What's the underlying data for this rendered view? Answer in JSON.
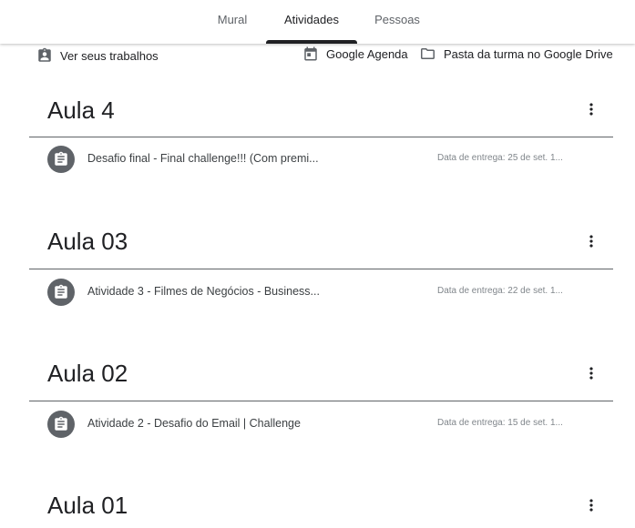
{
  "nav": {
    "tabs": [
      {
        "label": "Mural"
      },
      {
        "label": "Atividades"
      },
      {
        "label": "Pessoas"
      }
    ],
    "active_tab": "Atividades"
  },
  "toolbar": {
    "view_work_label": "Ver seus trabalhos",
    "calendar_label": "Google Agenda",
    "drive_label": "Pasta da turma no Google Drive"
  },
  "topics": [
    {
      "title": "Aula 4",
      "assignment": {
        "title": "Desafio final - Final challenge!!! (Com premi...",
        "due": "Data de entrega: 25 de set. 1..."
      }
    },
    {
      "title": "Aula 03",
      "assignment": {
        "title": "Atividade 3 - Filmes de Negócios - Business...",
        "due": "Data de entrega: 22 de set. 1..."
      }
    },
    {
      "title": "Aula 02",
      "assignment": {
        "title": "Atividade 2 - Desafio do Email | Challenge",
        "due": "Data de entrega: 15 de set. 1..."
      }
    },
    {
      "title": "Aula 01"
    }
  ],
  "icons": {
    "view_work": "assignment-ind-icon",
    "calendar": "calendar-icon",
    "drive": "folder-icon",
    "assignment": "assignment-icon",
    "menu": "more-vert-icon"
  },
  "colors": {
    "icon_circle": "#5f6368",
    "active_indicator": "#202124",
    "divider": "#5f6368"
  }
}
